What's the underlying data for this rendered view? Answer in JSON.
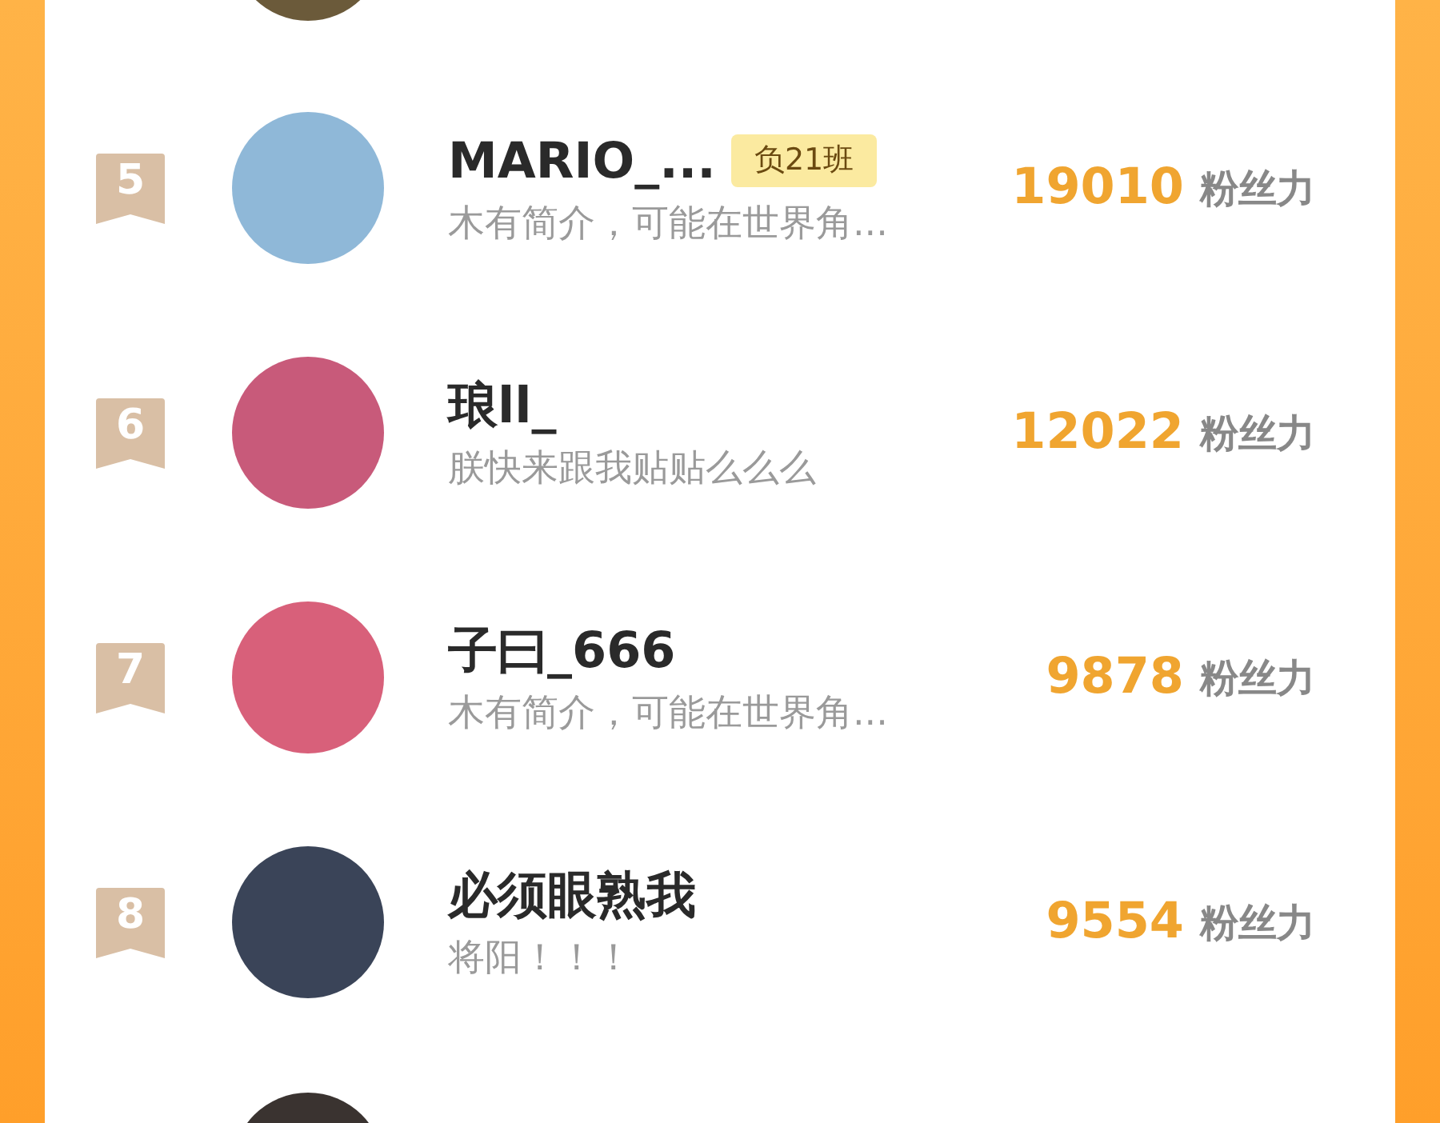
{
  "ranking": [
    {
      "rank": "5",
      "name": "MARIO_...",
      "tag": "负21班",
      "bio": "木有简介，可能在世界角...",
      "score": "19010",
      "score_unit": "粉丝力"
    },
    {
      "rank": "6",
      "name": "琅ll_",
      "bio": "朕快来跟我贴贴么么么",
      "score": "12022",
      "score_unit": "粉丝力"
    },
    {
      "rank": "7",
      "name": "子曰_666",
      "bio": "木有简介，可能在世界角...",
      "score": "9878",
      "score_unit": "粉丝力"
    },
    {
      "rank": "8",
      "name": "必须眼熟我",
      "bio": "将阳！！！",
      "score": "9554",
      "score_unit": "粉丝力"
    }
  ]
}
